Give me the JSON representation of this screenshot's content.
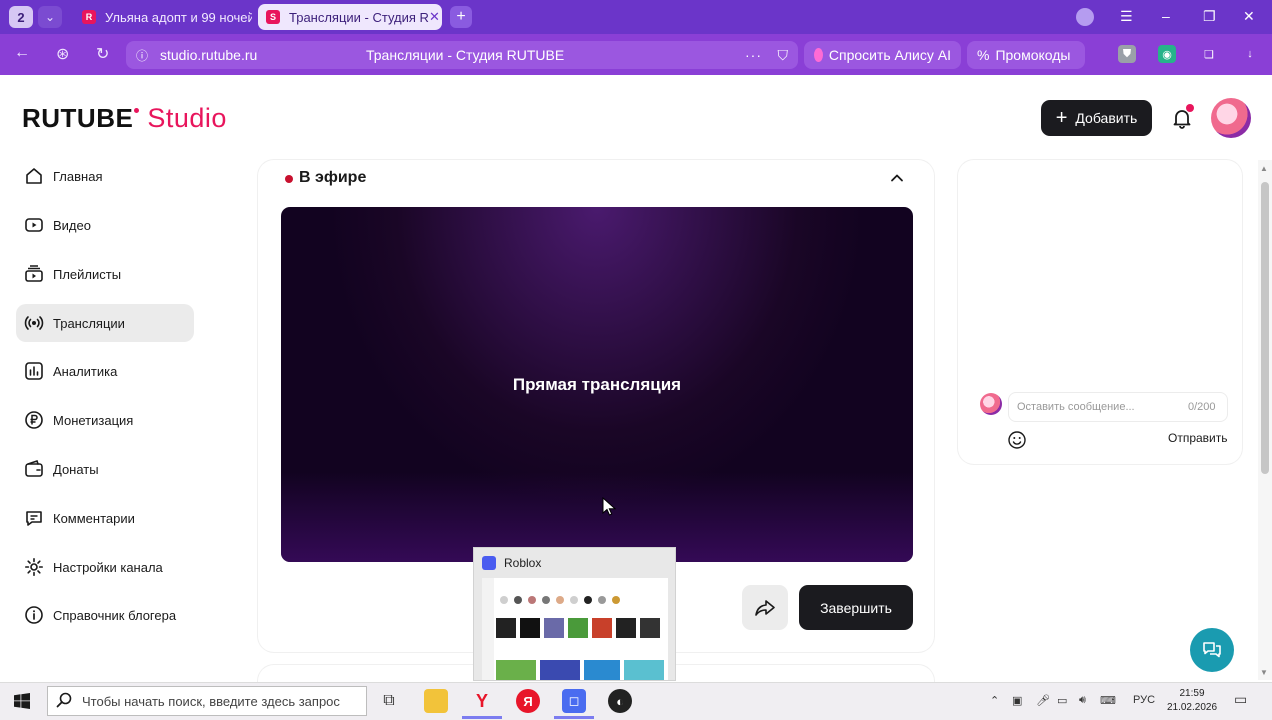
{
  "browser": {
    "tab_count": "2",
    "tabs": [
      {
        "label": "Ульяна адопт и 99 ночей",
        "active": false
      },
      {
        "label": "Трансляции - Студия R",
        "active": true
      }
    ],
    "url": "studio.rutube.ru",
    "page_title": "Трансляции - Студия RUTUBE",
    "alice_label": "Спросить Алису AI",
    "promo_label": "Промокоды"
  },
  "header": {
    "logo_main": "RUTUBE",
    "logo_studio": "Studio",
    "add_label": "Добавить"
  },
  "sidebar": {
    "items": [
      {
        "label": "Главная",
        "icon": "home-icon"
      },
      {
        "label": "Видео",
        "icon": "video-icon"
      },
      {
        "label": "Плейлисты",
        "icon": "playlist-icon"
      },
      {
        "label": "Трансляции",
        "icon": "broadcast-icon",
        "active": true
      },
      {
        "label": "Аналитика",
        "icon": "analytics-icon"
      },
      {
        "label": "Монетизация",
        "icon": "ruble-icon"
      },
      {
        "label": "Донаты",
        "icon": "wallet-icon"
      },
      {
        "label": "Комментарии",
        "icon": "comment-icon"
      },
      {
        "label": "Настройки канала",
        "icon": "gear-icon"
      },
      {
        "label": "Справочник блогера",
        "icon": "info-icon"
      }
    ]
  },
  "stream": {
    "status_label": "В эфире",
    "player_text": "Прямая трансляция",
    "finish_label": "Завершить"
  },
  "chat": {
    "input_placeholder": "Оставить сообщение...",
    "counter": "0/200",
    "send_label": "Отправить"
  },
  "taskbar": {
    "search_placeholder": "Чтобы начать поиск, введите здесь запрос",
    "preview_title": "Roblox",
    "language": "РУС",
    "time": "21:59",
    "date": "21.02.2026"
  },
  "colors": {
    "browser_tabbar": "#6b35c9",
    "browser_addrbar": "#8a3fd6",
    "brand_accent": "#e8155c",
    "live_red": "#c8102e",
    "dark_button": "#1b1b1f",
    "support_teal": "#1a9bb0"
  }
}
